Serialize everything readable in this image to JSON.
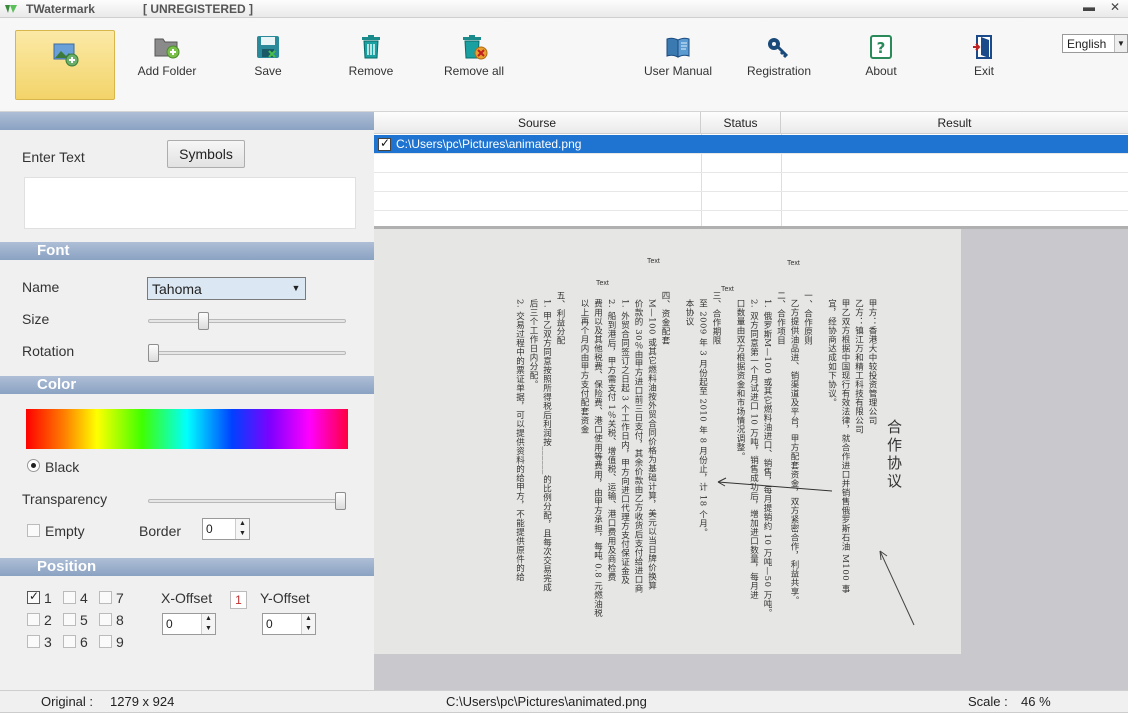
{
  "window": {
    "title": "TWatermark",
    "registration": "[ UNREGISTERED ]"
  },
  "toolbar": {
    "add_folder": "Add Folder",
    "save": "Save",
    "remove": "Remove",
    "remove_all": "Remove all",
    "user_manual": "User Manual",
    "registration": "Registration",
    "about": "About",
    "exit": "Exit",
    "language": "English"
  },
  "text_panel": {
    "enter_text_label": "Enter Text",
    "symbols_button": "Symbols",
    "text_value": ""
  },
  "font": {
    "section": "Font",
    "name_label": "Name",
    "name_value": "Tahoma",
    "size_label": "Size",
    "size_level": 0.27,
    "rotation_label": "Rotation",
    "rotation_level": 0.0
  },
  "color": {
    "section": "Color",
    "black_label": "Black",
    "transparency_label": "Transparency",
    "transparency_level": 1.0,
    "empty_label": "Empty",
    "border_label": "Border",
    "border_value": "0"
  },
  "position": {
    "section": "Position",
    "checkboxes": [
      {
        "label": "1",
        "checked": true
      },
      {
        "label": "4",
        "checked": false
      },
      {
        "label": "7",
        "checked": false
      },
      {
        "label": "2",
        "checked": false
      },
      {
        "label": "5",
        "checked": false
      },
      {
        "label": "8",
        "checked": false
      },
      {
        "label": "3",
        "checked": false
      },
      {
        "label": "6",
        "checked": false
      },
      {
        "label": "9",
        "checked": false
      }
    ],
    "x_offset_label": "X-Offset",
    "y_offset_label": "Y-Offset",
    "x_offset_value": "0",
    "y_offset_value": "0",
    "selected_position": "1"
  },
  "file_grid": {
    "columns": [
      "Sourse",
      "Status",
      "Result"
    ],
    "rows": [
      {
        "source": "C:\\Users\\pc\\Pictures\\animated.png",
        "status": "",
        "result": "",
        "checked": true
      }
    ]
  },
  "preview": {
    "watermark_text": "Text",
    "doc_title": "合作协议",
    "doc_lines": [
      "甲方：香港大中较投资管理公司",
      "乙方：镇江万和精工科技有限公司",
      "甲乙双方根据中国现行有效法律，就合作进口并销售俄罗斯石油 M100 事",
      "宜，经协商达成如下协议。",
      "一、合作原则",
      "乙方提供油品进、销渠道及平台，甲方配套资金，双方紧密合作，利益共享。",
      "二、合作项目",
      "1. 俄罗斯M—100 或其它燃料油进口、销售，每月提销约 10 万吨—50 万吨。",
      "2. 双方同意第一个月试进口 10 万吨，销售成功后，增加进口数量，每月进",
      "口数量由双方根据资金和市场情况调整。",
      "三、合作期限",
      "至 2009 年 3 月份起至 2010 年 8 月份止，计 18 个月。",
      "本协议",
      "四、资金配套",
      "M—100 或其它燃料油按外贸合同价格为基础计算，美元以当日牌价换算",
      "价款的 30％由甲方进口前三日支付，其余价款由乙方收货后支付给进口商",
      "1. 外贸合同签订之日起 3 个工作日内，甲方向进口代理方支付保证金及",
      "2. 船到港后，甲方需支付 1％关税、增值税、运输、港口费用及商检费",
      "费用以及其他税费、保险费、港口使用等费用，由甲方承担，每吨 0.8 元燃油税",
      "以上再个月内由甲方支付配套资金",
      "五、利益分配",
      "1. 甲乙双方同意按照所得税后利润按______的比例分配，且每次交易完成",
      "后三个工作日内分配。",
      "2. 交易过程中的票证单据，可以提供资料的给甲方，不能提供原件的给"
    ]
  },
  "status_bar": {
    "original_label": "Original :",
    "original_value": "1279 x 924",
    "path": "C:\\Users\\pc\\Pictures\\animated.png",
    "scale_label": "Scale :",
    "scale_value": "46 %"
  },
  "icons": {
    "app": "watermark-app-icon",
    "add_image": "add-image-icon",
    "add_folder": "add-folder-icon",
    "save": "save-icon",
    "remove": "trash-icon",
    "remove_all": "trash-x-icon",
    "user_manual": "book-icon",
    "registration": "key-icon",
    "about": "help-icon",
    "exit": "exit-door-icon"
  },
  "colors": {
    "section_header": "#8aa2c2",
    "selection": "#1e74d0",
    "active_tool": "#f3d46a"
  }
}
